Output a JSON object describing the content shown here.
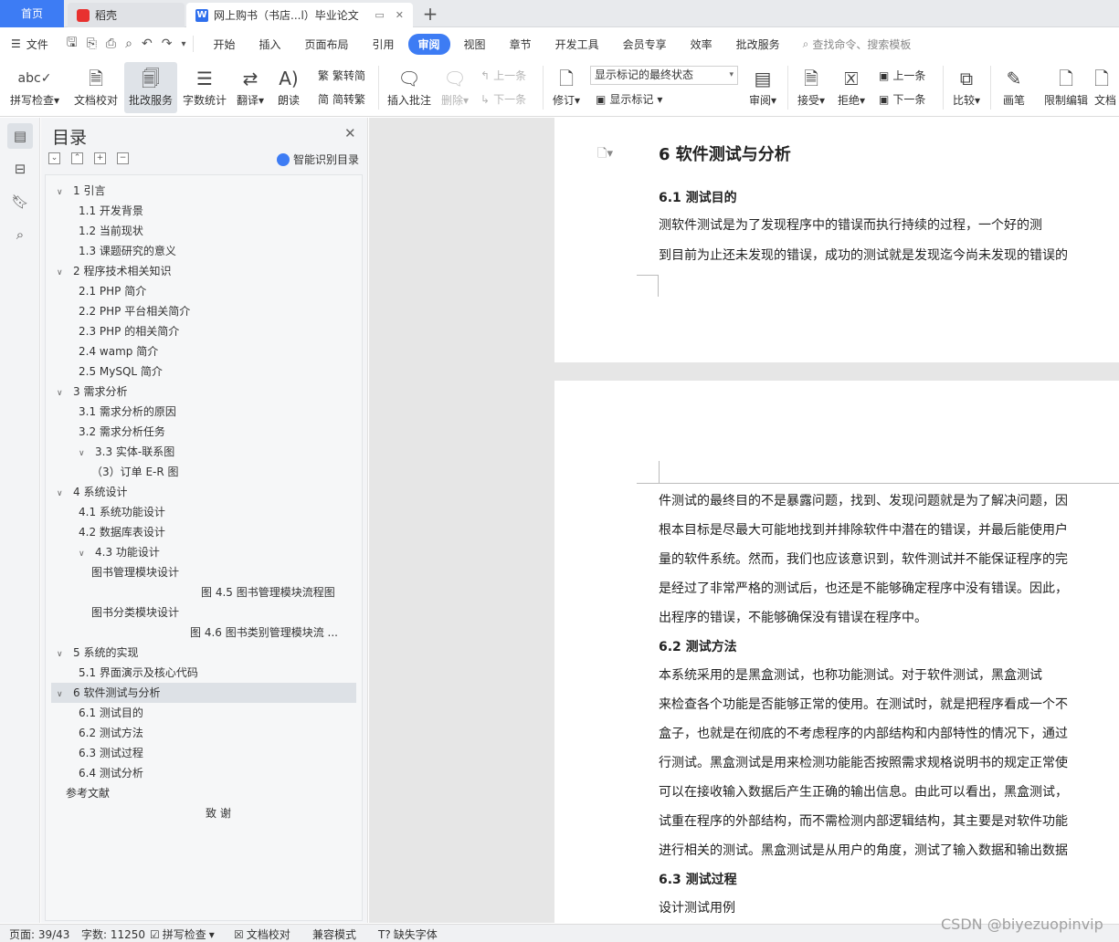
{
  "tabs": {
    "home": "首页",
    "daoke": "稻壳",
    "doc": "网上购书（书店...l）毕业论文",
    "plus": "+"
  },
  "menu": {
    "file": "文件",
    "items": [
      "开始",
      "插入",
      "页面布局",
      "引用",
      "审阅",
      "视图",
      "章节",
      "开发工具",
      "会员专享",
      "效率",
      "批改服务"
    ],
    "active_index": 4,
    "search": "查找命令、搜索模板"
  },
  "ribbon": {
    "spell": "拼写检查",
    "proofread": "文档校对",
    "revise_service": "批改服务",
    "word_count": "字数统计",
    "translate": "翻译",
    "read_aloud": "朗读",
    "to_traditional": "繁转简",
    "to_simplified": "简转繁",
    "insert_comment": "插入批注",
    "delete": "删除",
    "prev": "上一条",
    "next": "下一条",
    "track": "修订",
    "markup_select": "显示标记的最终状态",
    "show_markup": "显示标记",
    "review": "审阅",
    "accept": "接受",
    "reject": "拒绝",
    "prev2": "上一条",
    "next2": "下一条",
    "compare": "比较",
    "pen": "画笔",
    "restrict": "限制编辑",
    "doc_trunc": "文档"
  },
  "nav": {
    "title": "目录",
    "smart": "智能识别目录",
    "toc": [
      {
        "text": "1    引言",
        "twisty": "∨",
        "indent": 0
      },
      {
        "text": "1.1  开发背景",
        "twisty": "",
        "indent": 1
      },
      {
        "text": "1.2  当前现状",
        "twisty": "",
        "indent": 1
      },
      {
        "text": "1.3  课题研究的意义",
        "twisty": "",
        "indent": 1
      },
      {
        "text": "2  程序技术相关知识",
        "twisty": "∨",
        "indent": 0
      },
      {
        "text": "2.1 PHP 简介",
        "twisty": "",
        "indent": 1
      },
      {
        "text": "2.2 PHP  平台相关简介",
        "twisty": "",
        "indent": 1
      },
      {
        "text": "2.3 PHP 的相关简介",
        "twisty": "",
        "indent": 1
      },
      {
        "text": "2.4 wamp 简介",
        "twisty": "",
        "indent": 1
      },
      {
        "text": "2.5 MySQL 简介",
        "twisty": "",
        "indent": 1
      },
      {
        "text": "3    需求分析",
        "twisty": "∨",
        "indent": 0
      },
      {
        "text": "3.1  需求分析的原因",
        "twisty": "",
        "indent": 1
      },
      {
        "text": "3.2 需求分析任务",
        "twisty": "",
        "indent": 1
      },
      {
        "text": "3.3 实体-联系图",
        "twisty": "∨",
        "indent": 1
      },
      {
        "text": "（3）订单 E-R 图",
        "twisty": "",
        "indent": 2
      },
      {
        "text": "4    系统设计",
        "twisty": "∨",
        "indent": 0
      },
      {
        "text": "4.1  系统功能设计",
        "twisty": "",
        "indent": 1
      },
      {
        "text": "4.2 数据库表设计",
        "twisty": "",
        "indent": 1
      },
      {
        "text": "4.3    功能设计",
        "twisty": "∨",
        "indent": 1
      },
      {
        "text": "图书管理模块设计",
        "twisty": "",
        "indent": 2
      },
      {
        "text": "图 4.5 图书管理模块流程图",
        "twisty": "",
        "indent": 3
      },
      {
        "text": "图书分类模块设计",
        "twisty": "",
        "indent": 2
      },
      {
        "text": "图 4.6  图书类别管理模块流 ...",
        "twisty": "",
        "indent": 4
      },
      {
        "text": "5  系统的实现",
        "twisty": "∨",
        "indent": 0
      },
      {
        "text": "5.1  界面演示及核心代码",
        "twisty": "",
        "indent": 1
      },
      {
        "text": "6    软件测试与分析",
        "twisty": "∨",
        "indent": 0,
        "selected": true
      },
      {
        "text": "6.1  测试目的",
        "twisty": "",
        "indent": 1
      },
      {
        "text": "6.2  测试方法",
        "twisty": "",
        "indent": 1
      },
      {
        "text": "6.3  测试过程",
        "twisty": "",
        "indent": 1
      },
      {
        "text": "6.4  测试分析",
        "twisty": "",
        "indent": 1
      },
      {
        "text": "参考文献",
        "twisty": "",
        "indent": 5
      },
      {
        "text": "致    谢",
        "twisty": "",
        "indent": 6
      }
    ]
  },
  "doc": {
    "h1": "6    软件测试与分析",
    "s61": "6.1  测试目的",
    "p1": "        测软件测试是为了发现程序中的错误而执行持续的过程，一个好的测",
    "p2": "到目前为止还未发现的错误，成功的测试就是发现迄今尚未发现的错误的",
    "lines2": [
      "件测试的最终目的不是暴露问题，找到、发现问题就是为了解决问题，因",
      "根本目标是尽最大可能地找到并排除软件中潜在的错误，并最后能使用户",
      "量的软件系统。然而，我们也应该意识到，软件测试并不能保证程序的完",
      "是经过了非常严格的测试后，也还是不能够确定程序中没有错误。因此，",
      "出程序的错误，不能够确保没有错误在程序中。"
    ],
    "s62": "6.2  测试方法",
    "lines3": [
      "        本系统采用的是黑盒测试，也称功能测试。对于软件测试，黑盒测试",
      "来检查各个功能是否能够正常的使用。在测试时，就是把程序看成一个不",
      "盒子，也就是在彻底的不考虑程序的内部结构和内部特性的情况下，通过",
      "行测试。黑盒测试是用来检测功能能否按照需求规格说明书的规定正常使",
      "可以在接收输入数据后产生正确的输出信息。由此可以看出，黑盒测试，",
      "试重在程序的外部结构，而不需检测内部逻辑结构，其主要是对软件功能",
      "进行相关的测试。黑盒测试是从用户的角度，测试了输入数据和输出数据"
    ],
    "s63": "6.3  测试过程",
    "p_last": "设计测试用例"
  },
  "status": {
    "page": "页面: 39/43",
    "words": "字数: 11250",
    "spell": "拼写检查",
    "proof": "文档校对",
    "compat": "兼容模式",
    "font": "缺失字体"
  },
  "watermark": "CSDN @biyezuopinvip"
}
